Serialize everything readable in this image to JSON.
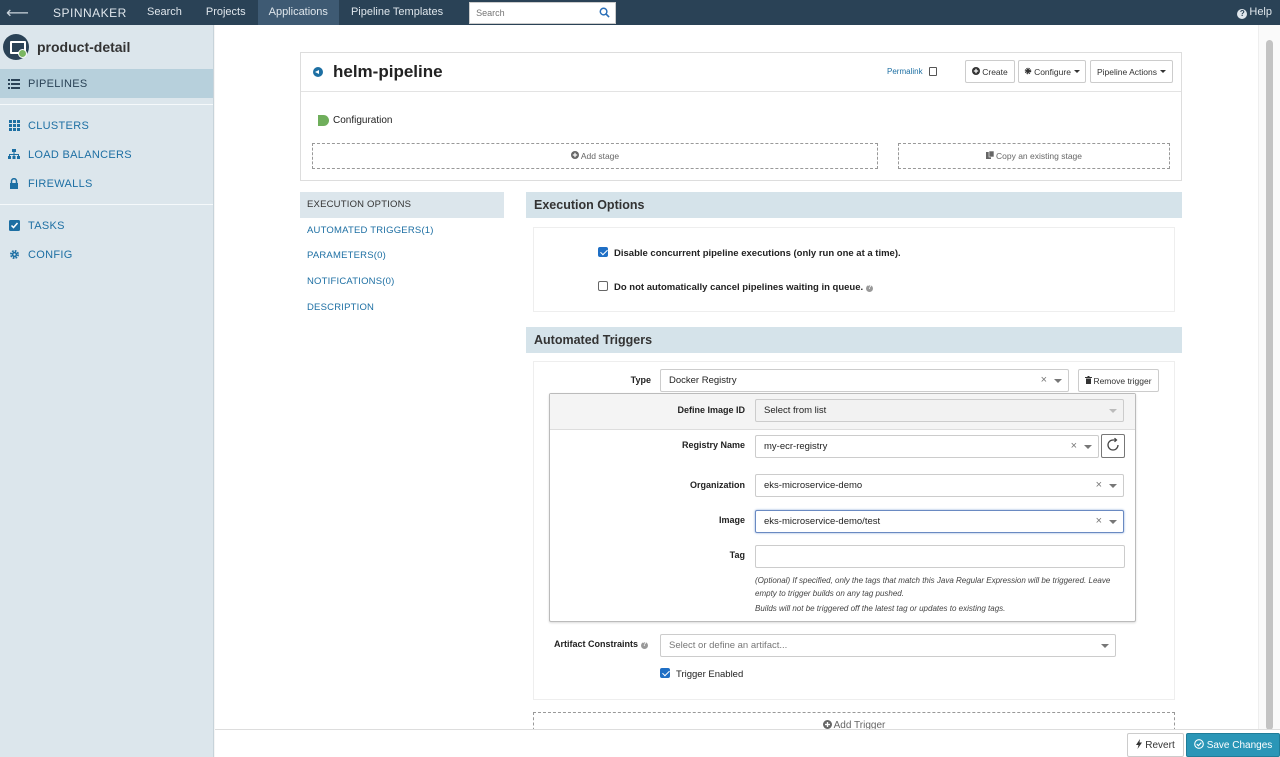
{
  "topnav": {
    "brand": "SPINNAKER",
    "links": [
      "Search",
      "Projects",
      "Applications",
      "Pipeline Templates"
    ],
    "search_placeholder": "Search",
    "help": "Help"
  },
  "sidebar": {
    "app_name": "product-detail",
    "items": [
      "PIPELINES",
      "CLUSTERS",
      "LOAD BALANCERS",
      "FIREWALLS",
      "TASKS",
      "CONFIG"
    ]
  },
  "pipeline": {
    "title": "helm-pipeline",
    "permalink": "Permalink",
    "create": "Create",
    "configure": "Configure",
    "pipeline_actions": "Pipeline Actions",
    "configuration": "Configuration",
    "add_stage": "Add stage",
    "copy_stage": "Copy an existing stage"
  },
  "options_nav": [
    "EXECUTION OPTIONS",
    "AUTOMATED TRIGGERS(1)",
    "PARAMETERS(0)",
    "NOTIFICATIONS(0)",
    "DESCRIPTION"
  ],
  "execution_options": {
    "title": "Execution Options",
    "disable_concurrent": "Disable concurrent pipeline executions (only run one at a time).",
    "no_cancel": "Do not automatically cancel pipelines waiting in queue."
  },
  "triggers": {
    "title": "Automated Triggers",
    "type_label": "Type",
    "type_value": "Docker Registry",
    "remove": "Remove trigger",
    "define_image_label": "Define Image ID",
    "define_image_value": "Select from list",
    "registry_label": "Registry Name",
    "registry_value": "my-ecr-registry",
    "org_label": "Organization",
    "org_value": "eks-microservice-demo",
    "image_label": "Image",
    "image_value": "eks-microservice-demo/test",
    "tag_label": "Tag",
    "tag_value": "",
    "tag_help1": "(Optional) If specified, only the tags that match this Java Regular Expression will be triggered. Leave empty to trigger builds on any tag pushed.",
    "tag_help2": "Builds will not be triggered off the latest tag or updates to existing tags.",
    "artifact_label": "Artifact Constraints",
    "artifact_placeholder": "Select or define an artifact...",
    "trigger_enabled": "Trigger Enabled",
    "add_trigger": "Add Trigger"
  },
  "footer": {
    "revert": "Revert",
    "save": "Save Changes"
  },
  "colors": {
    "nav": "#2a4256",
    "sidebar": "#dce6ec",
    "link": "#1d6fa3",
    "save": "#2a96b7"
  }
}
